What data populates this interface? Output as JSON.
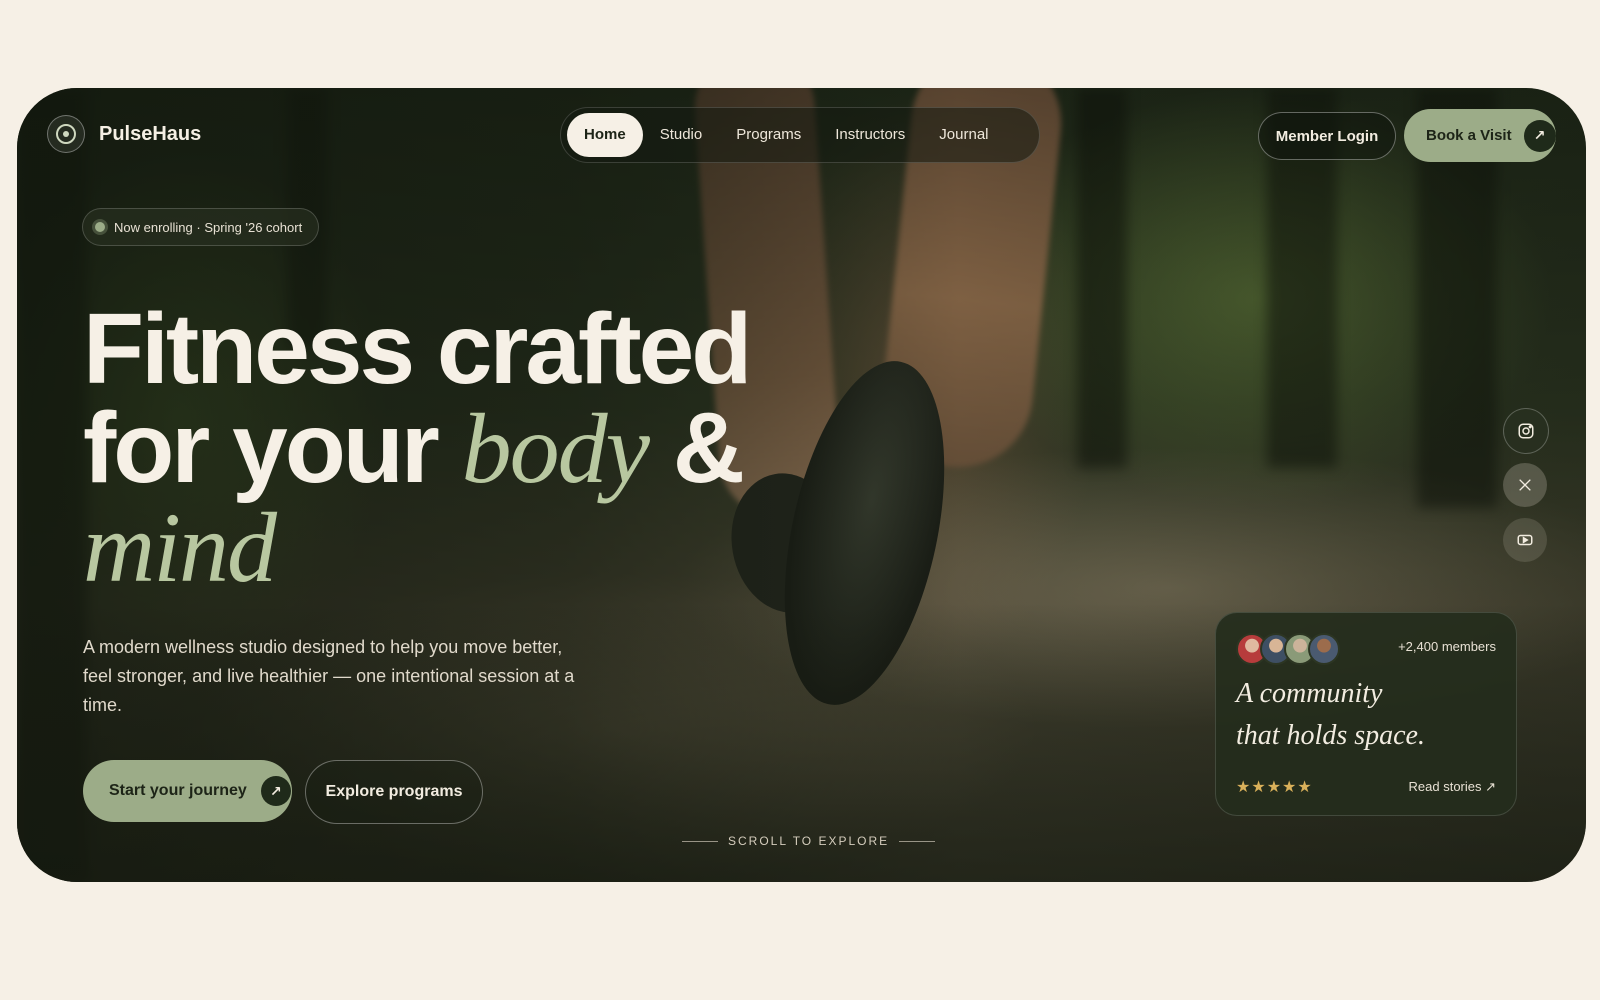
{
  "brand": {
    "name": "PulseHaus"
  },
  "nav": {
    "items": [
      {
        "label": "Home",
        "active": true
      },
      {
        "label": "Studio"
      },
      {
        "label": "Programs"
      },
      {
        "label": "Instructors"
      },
      {
        "label": "Journal"
      }
    ]
  },
  "header": {
    "member_login": "Member Login",
    "book_visit": "Book a Visit"
  },
  "hero": {
    "badge": "Now enrolling · Spring '26 cohort",
    "headline_line1": "Fitness crafted",
    "headline_line2_a": "for your ",
    "headline_line2_italic": "body",
    "headline_line2_b": " &",
    "headline_line3_italic": "mind",
    "lede": "A modern wellness studio designed to help you move better, feel stronger, and live healthier — one intentional session at a time.",
    "cta_primary": "Start your journey",
    "cta_secondary": "Explore programs",
    "scroll_hint": "SCROLL TO EXPLORE"
  },
  "social": [
    "instagram-icon",
    "x-icon",
    "youtube-icon"
  ],
  "community_card": {
    "member_count": "+2,400 members",
    "quote_line1": "A community",
    "quote_line2": "that holds space.",
    "rating_stars": "★★★★★",
    "read_link": "Read stories ↗"
  },
  "colors": {
    "background": "#f6f0e6",
    "accent": "#9cac88",
    "dark": "#1f2a1a",
    "star": "#d9b05a"
  }
}
